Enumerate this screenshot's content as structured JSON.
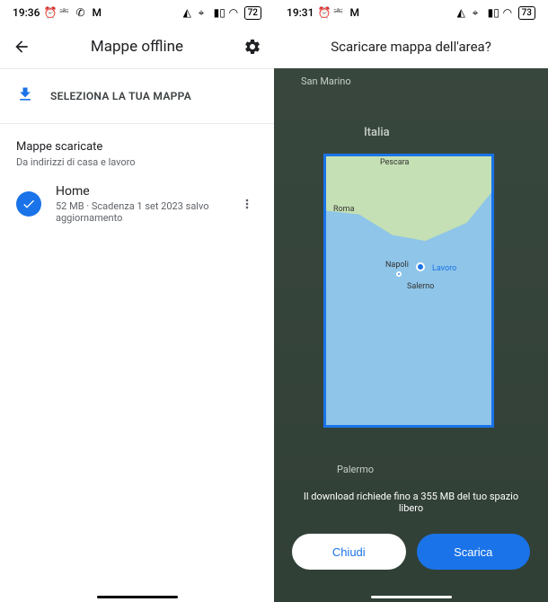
{
  "left": {
    "status": {
      "time": "19:36",
      "battery": "72"
    },
    "header": {
      "title": "Mappe offline"
    },
    "select_map": {
      "label": "SELEZIONA LA TUA MAPPA"
    },
    "downloaded": {
      "title": "Mappe scaricate",
      "subtitle": "Da indirizzi di casa e lavoro",
      "items": [
        {
          "name": "Home",
          "meta": "52 MB · Scadenza 1 set 2023 salvo aggiornamento"
        }
      ]
    }
  },
  "right": {
    "status": {
      "time": "19:31",
      "battery": "73"
    },
    "header": {
      "title": "Scaricare mappa dell'area?"
    },
    "map": {
      "bg_labels": {
        "sanmarino": "San Marino",
        "italia": "Italia",
        "palermo": "Palermo"
      },
      "labels": {
        "roma": "Roma",
        "napoli": "Napoli",
        "lavoro": "Lavoro",
        "salerno": "Salerno",
        "pescara": "Pescara"
      }
    },
    "info": "Il download richiede fino a 355 MB del tuo spazio libero",
    "buttons": {
      "close": "Chiudi",
      "download": "Scarica"
    }
  }
}
